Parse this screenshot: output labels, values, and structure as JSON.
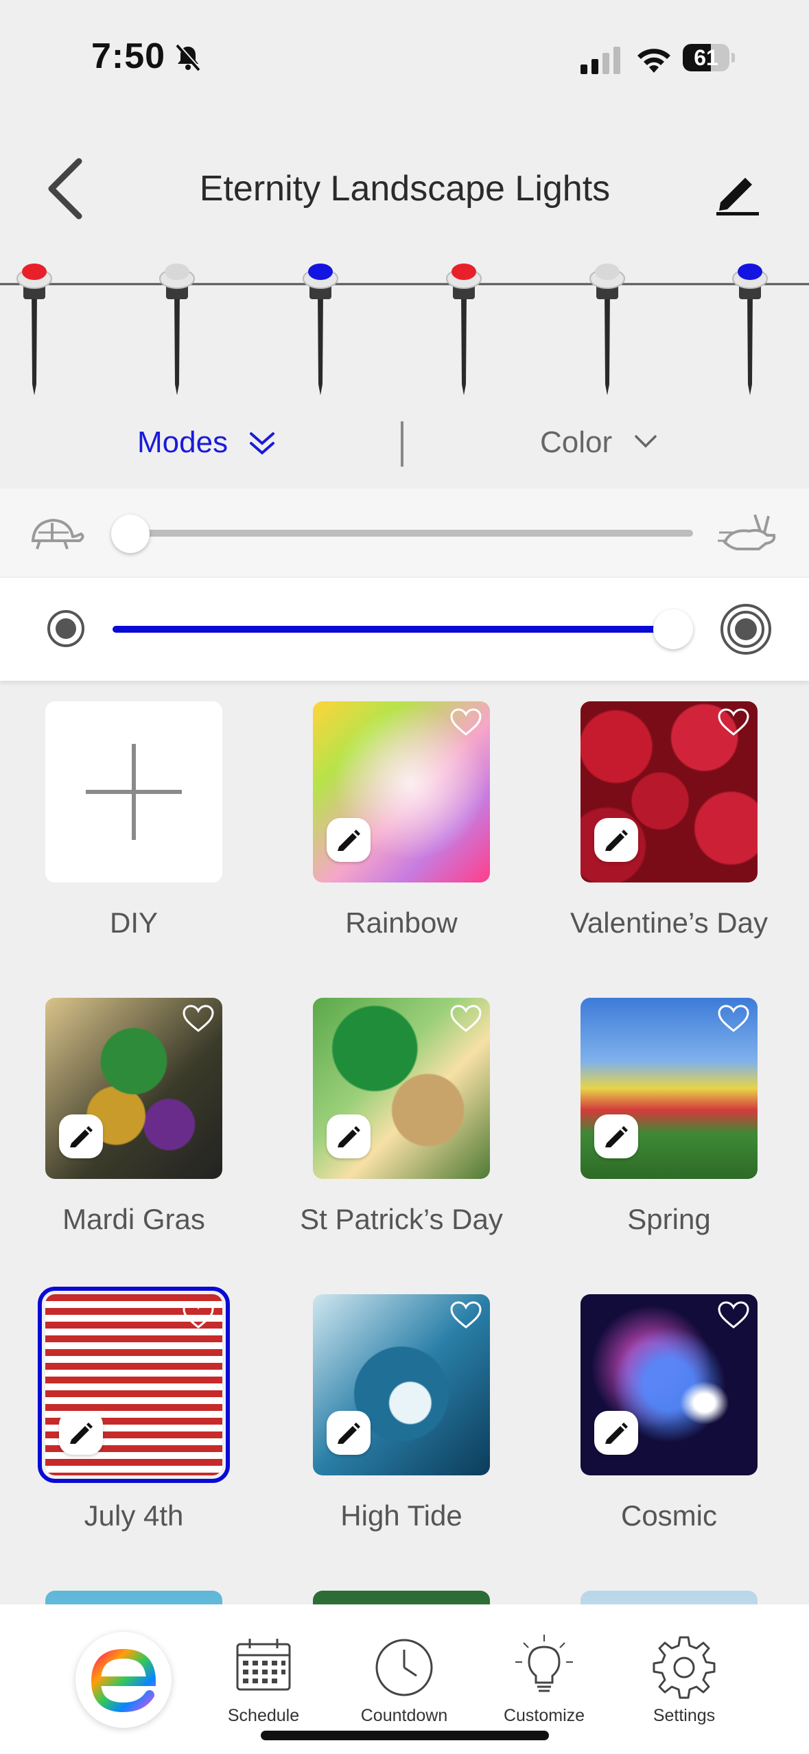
{
  "status_bar": {
    "time": "7:50",
    "battery": "61"
  },
  "header": {
    "title": "Eternity Landscape Lights"
  },
  "tabs": {
    "modes": "Modes",
    "color": "Color"
  },
  "sliders": {
    "speed": 0.0,
    "brightness": 1.0
  },
  "colors": {
    "accent": "#0a0ad6",
    "light_red": "#e8202a",
    "light_white": "#d8d8d8",
    "light_blue": "#1414e0"
  },
  "lights": [
    "red",
    "white",
    "blue",
    "red",
    "white",
    "blue"
  ],
  "modes": [
    {
      "label": "DIY"
    },
    {
      "label": "Rainbow"
    },
    {
      "label": "Valentine’s Day"
    },
    {
      "label": "Mardi Gras"
    },
    {
      "label": "St Patrick’s Day"
    },
    {
      "label": "Spring"
    },
    {
      "label": "July 4th",
      "selected": true
    },
    {
      "label": "High Tide"
    },
    {
      "label": "Cosmic"
    }
  ],
  "nav": {
    "schedule": "Schedule",
    "countdown": "Countdown",
    "customize": "Customize",
    "settings": "Settings"
  }
}
